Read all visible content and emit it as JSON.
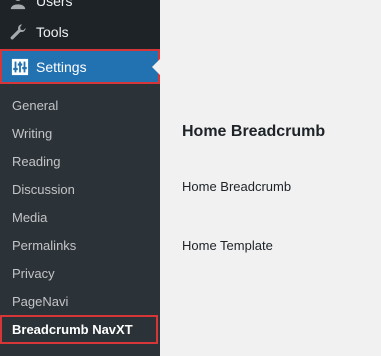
{
  "sidebar": {
    "menu": [
      {
        "label": "Users",
        "icon": "users-icon"
      },
      {
        "label": "Tools",
        "icon": "wrench-icon"
      },
      {
        "label": "Settings",
        "icon": "settings-icon"
      }
    ],
    "submenu": [
      {
        "label": "General"
      },
      {
        "label": "Writing"
      },
      {
        "label": "Reading"
      },
      {
        "label": "Discussion"
      },
      {
        "label": "Media"
      },
      {
        "label": "Permalinks"
      },
      {
        "label": "Privacy"
      },
      {
        "label": "PageNavi"
      },
      {
        "label": "Breadcrumb NavXT"
      }
    ]
  },
  "main": {
    "heading": "Home Breadcrumb",
    "fields": [
      {
        "label": "Home Breadcrumb"
      },
      {
        "label": "Home Template"
      }
    ]
  },
  "colors": {
    "sidebar_bg": "#1d2327",
    "submenu_bg": "#2c3338",
    "active_bg": "#2271b1",
    "highlight_border": "#d63638",
    "content_bg": "#f1f1f1"
  }
}
